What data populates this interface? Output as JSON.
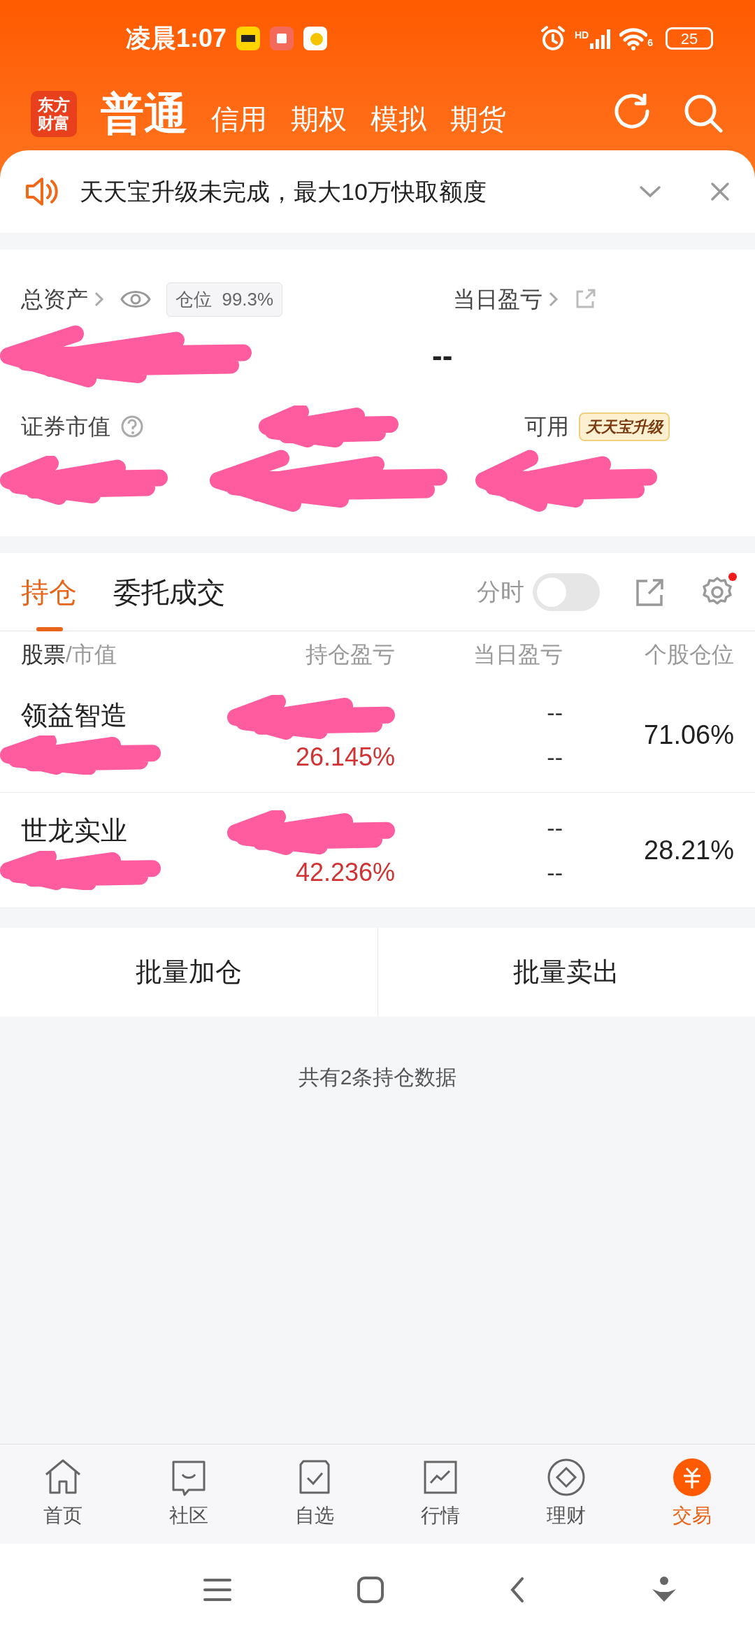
{
  "status_bar": {
    "time": "凌晨1:07",
    "network": "HD",
    "wifi": "6",
    "battery": "25"
  },
  "header": {
    "logo": [
      "东方",
      "财富"
    ],
    "tabs": [
      {
        "label": "普通",
        "selected": true
      },
      {
        "label": "信用",
        "selected": false
      },
      {
        "label": "期权",
        "selected": false
      },
      {
        "label": "模拟",
        "selected": false
      },
      {
        "label": "期货",
        "selected": false
      }
    ]
  },
  "notice": {
    "text": "天天宝升级未完成，最大10万快取额度"
  },
  "assets": {
    "total_label": "总资产",
    "position_label": "仓位",
    "position_value": "99.3%",
    "day_pnl_label": "当日盈亏",
    "day_pnl_value": "--",
    "market_value_label": "证券市值",
    "available_label": "可用",
    "upgrade_badge": "天天宝升级"
  },
  "holding_tabs": [
    {
      "label": "持仓",
      "selected": true
    },
    {
      "label": "委托成交",
      "selected": false
    }
  ],
  "intraday": {
    "label": "分时",
    "on": false
  },
  "settings": {
    "has_notification": true
  },
  "table": {
    "columns": [
      {
        "label": "股票",
        "secondary": "/市值"
      },
      {
        "label": "持仓盈亏"
      },
      {
        "label": "当日盈亏"
      },
      {
        "label": "个股仓位"
      }
    ],
    "rows": [
      {
        "name": "领益智造",
        "pnl_rate": "26.145%",
        "day_pnl": [
          "--",
          "--"
        ],
        "weight": "71.06%"
      },
      {
        "name": "世龙实业",
        "pnl_rate": "42.236%",
        "day_pnl": [
          "--",
          "--"
        ],
        "weight": "28.21%"
      }
    ]
  },
  "actions": [
    "批量加仓",
    "批量卖出"
  ],
  "footer_note": "共有2条持仓数据",
  "nav": [
    {
      "label": "首页",
      "selected": false
    },
    {
      "label": "社区",
      "selected": false
    },
    {
      "label": "自选",
      "selected": false
    },
    {
      "label": "行情",
      "selected": false
    },
    {
      "label": "理财",
      "selected": false
    },
    {
      "label": "交易",
      "selected": true
    }
  ]
}
